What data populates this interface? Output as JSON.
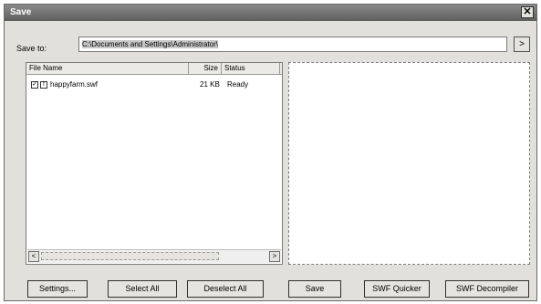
{
  "window": {
    "title": "Save",
    "close_glyph": "✕"
  },
  "save_to": {
    "label": "Save to:",
    "path": "C:\\Documents and Settings\\Administrator\\",
    "browse_label": ">"
  },
  "file_list": {
    "columns": {
      "name": "File Name",
      "size": "Size",
      "status": "Status"
    },
    "rows": [
      {
        "checked": true,
        "name": "happyfarm.swf",
        "size": "21 KB",
        "status": "Ready"
      }
    ],
    "scroll_left": "<",
    "scroll_right": ">"
  },
  "buttons": {
    "settings": "Settings...",
    "select_all": "Select All",
    "deselect_all": "Deselect All",
    "save": "Save",
    "swf_quicker": "SWF Quicker",
    "swf_decompiler": "SWF Decompiler"
  }
}
